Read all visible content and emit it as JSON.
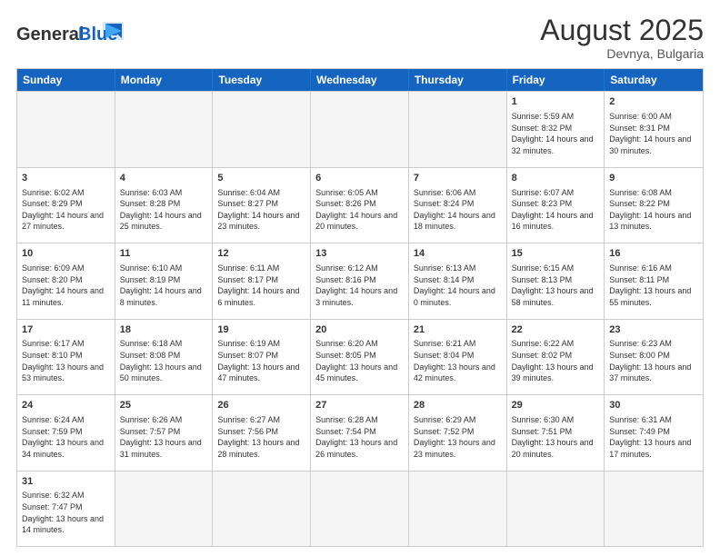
{
  "header": {
    "logo_general": "General",
    "logo_blue": "Blue",
    "month_year": "August 2025",
    "location": "Devnya, Bulgaria"
  },
  "calendar": {
    "weekdays": [
      "Sunday",
      "Monday",
      "Tuesday",
      "Wednesday",
      "Thursday",
      "Friday",
      "Saturday"
    ],
    "rows": [
      [
        {
          "day": "",
          "info": "",
          "empty": true
        },
        {
          "day": "",
          "info": "",
          "empty": true
        },
        {
          "day": "",
          "info": "",
          "empty": true
        },
        {
          "day": "",
          "info": "",
          "empty": true
        },
        {
          "day": "",
          "info": "",
          "empty": true
        },
        {
          "day": "1",
          "info": "Sunrise: 5:59 AM\nSunset: 8:32 PM\nDaylight: 14 hours and 32 minutes."
        },
        {
          "day": "2",
          "info": "Sunrise: 6:00 AM\nSunset: 8:31 PM\nDaylight: 14 hours and 30 minutes."
        }
      ],
      [
        {
          "day": "3",
          "info": "Sunrise: 6:02 AM\nSunset: 8:29 PM\nDaylight: 14 hours and 27 minutes."
        },
        {
          "day": "4",
          "info": "Sunrise: 6:03 AM\nSunset: 8:28 PM\nDaylight: 14 hours and 25 minutes."
        },
        {
          "day": "5",
          "info": "Sunrise: 6:04 AM\nSunset: 8:27 PM\nDaylight: 14 hours and 23 minutes."
        },
        {
          "day": "6",
          "info": "Sunrise: 6:05 AM\nSunset: 8:26 PM\nDaylight: 14 hours and 20 minutes."
        },
        {
          "day": "7",
          "info": "Sunrise: 6:06 AM\nSunset: 8:24 PM\nDaylight: 14 hours and 18 minutes."
        },
        {
          "day": "8",
          "info": "Sunrise: 6:07 AM\nSunset: 8:23 PM\nDaylight: 14 hours and 16 minutes."
        },
        {
          "day": "9",
          "info": "Sunrise: 6:08 AM\nSunset: 8:22 PM\nDaylight: 14 hours and 13 minutes."
        }
      ],
      [
        {
          "day": "10",
          "info": "Sunrise: 6:09 AM\nSunset: 8:20 PM\nDaylight: 14 hours and 11 minutes."
        },
        {
          "day": "11",
          "info": "Sunrise: 6:10 AM\nSunset: 8:19 PM\nDaylight: 14 hours and 8 minutes."
        },
        {
          "day": "12",
          "info": "Sunrise: 6:11 AM\nSunset: 8:17 PM\nDaylight: 14 hours and 6 minutes."
        },
        {
          "day": "13",
          "info": "Sunrise: 6:12 AM\nSunset: 8:16 PM\nDaylight: 14 hours and 3 minutes."
        },
        {
          "day": "14",
          "info": "Sunrise: 6:13 AM\nSunset: 8:14 PM\nDaylight: 14 hours and 0 minutes."
        },
        {
          "day": "15",
          "info": "Sunrise: 6:15 AM\nSunset: 8:13 PM\nDaylight: 13 hours and 58 minutes."
        },
        {
          "day": "16",
          "info": "Sunrise: 6:16 AM\nSunset: 8:11 PM\nDaylight: 13 hours and 55 minutes."
        }
      ],
      [
        {
          "day": "17",
          "info": "Sunrise: 6:17 AM\nSunset: 8:10 PM\nDaylight: 13 hours and 53 minutes."
        },
        {
          "day": "18",
          "info": "Sunrise: 6:18 AM\nSunset: 8:08 PM\nDaylight: 13 hours and 50 minutes."
        },
        {
          "day": "19",
          "info": "Sunrise: 6:19 AM\nSunset: 8:07 PM\nDaylight: 13 hours and 47 minutes."
        },
        {
          "day": "20",
          "info": "Sunrise: 6:20 AM\nSunset: 8:05 PM\nDaylight: 13 hours and 45 minutes."
        },
        {
          "day": "21",
          "info": "Sunrise: 6:21 AM\nSunset: 8:04 PM\nDaylight: 13 hours and 42 minutes."
        },
        {
          "day": "22",
          "info": "Sunrise: 6:22 AM\nSunset: 8:02 PM\nDaylight: 13 hours and 39 minutes."
        },
        {
          "day": "23",
          "info": "Sunrise: 6:23 AM\nSunset: 8:00 PM\nDaylight: 13 hours and 37 minutes."
        }
      ],
      [
        {
          "day": "24",
          "info": "Sunrise: 6:24 AM\nSunset: 7:59 PM\nDaylight: 13 hours and 34 minutes."
        },
        {
          "day": "25",
          "info": "Sunrise: 6:26 AM\nSunset: 7:57 PM\nDaylight: 13 hours and 31 minutes."
        },
        {
          "day": "26",
          "info": "Sunrise: 6:27 AM\nSunset: 7:56 PM\nDaylight: 13 hours and 28 minutes."
        },
        {
          "day": "27",
          "info": "Sunrise: 6:28 AM\nSunset: 7:54 PM\nDaylight: 13 hours and 26 minutes."
        },
        {
          "day": "28",
          "info": "Sunrise: 6:29 AM\nSunset: 7:52 PM\nDaylight: 13 hours and 23 minutes."
        },
        {
          "day": "29",
          "info": "Sunrise: 6:30 AM\nSunset: 7:51 PM\nDaylight: 13 hours and 20 minutes."
        },
        {
          "day": "30",
          "info": "Sunrise: 6:31 AM\nSunset: 7:49 PM\nDaylight: 13 hours and 17 minutes."
        }
      ],
      [
        {
          "day": "31",
          "info": "Sunrise: 6:32 AM\nSunset: 7:47 PM\nDaylight: 13 hours and 14 minutes."
        },
        {
          "day": "",
          "info": "",
          "empty": true
        },
        {
          "day": "",
          "info": "",
          "empty": true
        },
        {
          "day": "",
          "info": "",
          "empty": true
        },
        {
          "day": "",
          "info": "",
          "empty": true
        },
        {
          "day": "",
          "info": "",
          "empty": true
        },
        {
          "day": "",
          "info": "",
          "empty": true
        }
      ]
    ]
  }
}
